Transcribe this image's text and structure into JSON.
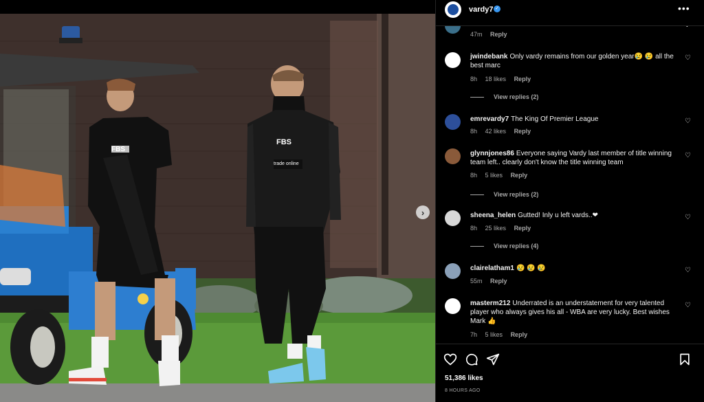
{
  "post": {
    "username": "vardy7",
    "likes_text": "51,386 likes",
    "time_ago": "8 HOURS AGO"
  },
  "icons": {
    "more": "more-options-icon",
    "heart": "heart-icon",
    "comment": "comment-icon",
    "share": "share-icon",
    "save": "bookmark-icon",
    "next": "chevron-right-icon"
  },
  "colors": {
    "background": "#000000",
    "verified": "#3897f0",
    "muted": "#a8a8a8"
  },
  "comments": [
    {
      "username": "",
      "text": "",
      "time": "47m",
      "likes": "",
      "reply": "Reply"
    },
    {
      "username": "jwindebank",
      "text": "Only vardy remains from our golden year😢 😢  all the best marc",
      "time": "8h",
      "likes": "18 likes",
      "reply": "Reply",
      "view_replies": "View replies (2)"
    },
    {
      "username": "emrevardy7",
      "text": "The King Of Premier League",
      "time": "8h",
      "likes": "42 likes",
      "reply": "Reply"
    },
    {
      "username": "glynnjones86",
      "text": "Everyone saying Vardy last member of title winning team left.. clearly don't know the title winning team",
      "time": "8h",
      "likes": "5 likes",
      "reply": "Reply",
      "view_replies": "View replies (2)"
    },
    {
      "username": "sheena_helen",
      "text": "Gutted! Inly u left vards..❤",
      "time": "8h",
      "likes": "25 likes",
      "reply": "Reply",
      "view_replies": "View replies (4)"
    },
    {
      "username": "clairelatham1",
      "text": "😢 😢 😢",
      "time": "55m",
      "likes": "",
      "reply": "Reply"
    },
    {
      "username": "masterm212",
      "text": "Underrated is an understatement for very talented player who always gives his all - WBA are very lucky. Best wishes Mark 👍",
      "time": "7h",
      "likes": "5 likes",
      "reply": "Reply"
    }
  ],
  "photo": {
    "shirt_text_1": "FBS",
    "shirt_text_2": "trade online"
  }
}
